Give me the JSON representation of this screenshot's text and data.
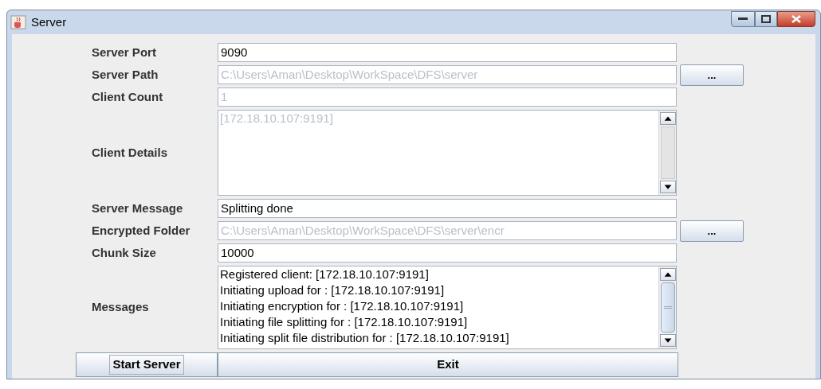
{
  "window": {
    "title": "Server"
  },
  "rows": [
    {
      "kind": "field",
      "label": "Server Port",
      "value": "9090",
      "disabled": false
    },
    {
      "kind": "field",
      "label": "Server Path",
      "value": "C:\\Users\\Aman\\Desktop\\WorkSpace\\DFS\\server",
      "disabled": true,
      "browse": "..."
    },
    {
      "kind": "field",
      "label": "Client Count",
      "value": "1",
      "disabled": true
    },
    {
      "kind": "area",
      "label": "Client Details",
      "lines": [
        "[172.18.10.107:9191]"
      ],
      "disabled": true,
      "scrolled": false
    },
    {
      "kind": "field",
      "label": "Server Message",
      "value": "Splitting done",
      "disabled": false
    },
    {
      "kind": "field",
      "label": "Encrypted Folder",
      "value": "C:\\Users\\Aman\\Desktop\\WorkSpace\\DFS\\server\\encr",
      "disabled": true,
      "browse": "..."
    },
    {
      "kind": "field",
      "label": "Chunk Size",
      "value": "10000",
      "disabled": false
    },
    {
      "kind": "area",
      "label": "Messages",
      "lines": [
        "Registered client: [172.18.10.107:9191]",
        "Initiating upload for : [172.18.10.107:9191]",
        "Initiating encryption for : [172.18.10.107:9191]",
        "Initiating file splitting for : [172.18.10.107:9191]",
        "Initiating split file distribution for : [172.18.10.107:9191]"
      ],
      "disabled": false,
      "scrolled": true
    }
  ],
  "buttons": [
    {
      "label": "Start Server",
      "focused": true
    },
    {
      "label": "Exit",
      "focused": false
    }
  ]
}
